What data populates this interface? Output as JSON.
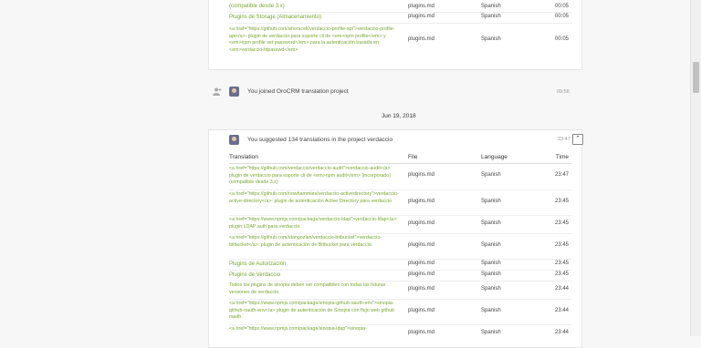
{
  "top_rows": [
    {
      "translation": "(compatible desde 3.x)",
      "file": "plugins.md",
      "language": "Spanish",
      "time": "00:05"
    },
    {
      "translation": "Plugins de Storage (Almacenamiento)",
      "file": "plugins.md",
      "language": "Spanish",
      "time": "00:05"
    },
    {
      "translation": "<a href=\"https://github.com/ahoracek/verdaccio-profile-api\">verdaccio-profile-api</a>: plugin de verdaccio para soporte cli de <em>npm profile</em> y <em>npm profile set password</em> para la autenticación basada en <em>verdaccio-htpasswd</em>",
      "file": "plugins.md",
      "language": "Spanish",
      "time": "00:05"
    }
  ],
  "joined_event": {
    "text": "You joined OroCRM translation project",
    "time": "09:58"
  },
  "date_separator": "Jun 19, 2018",
  "suggested_event": {
    "text": "You suggested 134 translations in the project verdaccio",
    "time": "23:47",
    "collapse_glyph": "⌃"
  },
  "table_headers": {
    "translation": "Translation",
    "file": "File",
    "language": "Language",
    "time": "Time"
  },
  "rows": [
    {
      "translation": "<a href=\"https://github.com/verdaccio/verdaccio-audit\">verdaccio-audit</a>: plugin de verdaccio para soporte cli de <em>npm audit</em> (incorporado) (compatible desde 3.x)",
      "file": "plugins.md",
      "language": "Spanish",
      "time": "23:47"
    },
    {
      "translation": "<a href=\"https://github.com/nowhammies/verdaccio-activedirectory\">verdaccio-active-directory</a>: plugin de autenticación Active Directory para verdaccio",
      "file": "plugins.md",
      "language": "Spanish",
      "time": "23:45"
    },
    {
      "translation": "<a href=\"https://www.npmjs.com/package/verdaccio-ldap\">verdaccio-ldap</a>: plugin LDAP auth para verdaccio.",
      "file": "plugins.md",
      "language": "Spanish",
      "time": "23:45"
    },
    {
      "translation": "<a href=\"https://github.com/idangozlan/verdaccio-bitbucket\">verdaccio-bitbucket</a>: plugin de autenticación de Bitbucket para verdaccio.",
      "file": "plugins.md",
      "language": "Spanish",
      "time": "23:45"
    },
    {
      "translation": "Plugins de Autorización",
      "file": "plugins.md",
      "language": "Spanish",
      "time": "23:45"
    },
    {
      "translation": "Plugins de Verdaccio",
      "file": "plugins.md",
      "language": "Spanish",
      "time": "23:45"
    },
    {
      "translation": "Todos los plugins de sinopia deben ser compatibles con todas las futuras versiones de verdaccio.",
      "file": "plugins.md",
      "language": "Spanish",
      "time": "23:44"
    },
    {
      "translation": "<a href=\"https://www.npmjs.com/package/sinopia-github-oauth-env\">sinopia-github-oauth-env</a> plugin de autenticación de Sinopia con flujo web github oauth.",
      "file": "plugins.md",
      "language": "Spanish",
      "time": "23:44"
    },
    {
      "translation": "<a href=\"https://www.npmjs.com/package/sinopia-ldap\">sinopia-",
      "file": "plugins.md",
      "language": "Spanish",
      "time": "23:44"
    }
  ]
}
